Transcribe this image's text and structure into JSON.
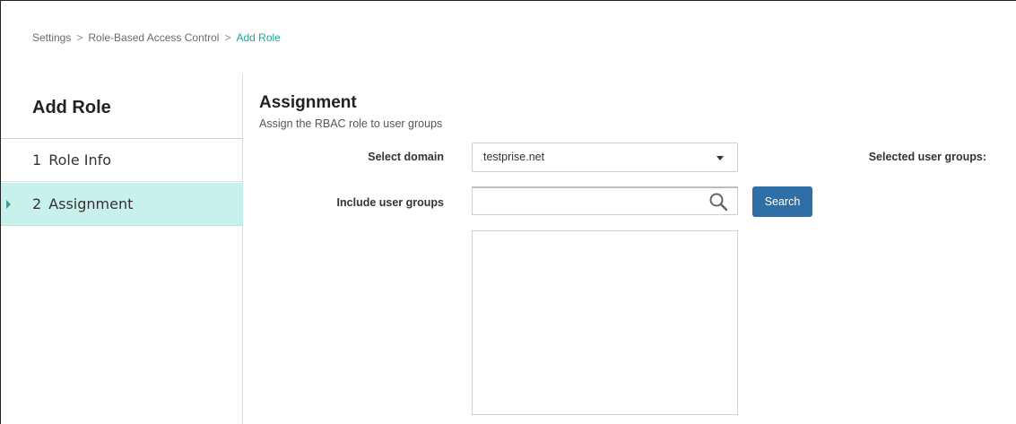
{
  "breadcrumb": {
    "items": [
      "Settings",
      "Role-Based Access Control",
      "Add Role"
    ],
    "separator": ">"
  },
  "sidebar": {
    "title": "Add Role",
    "steps": [
      {
        "number": "1",
        "label": "Role Info"
      },
      {
        "number": "2",
        "label": "Assignment"
      }
    ]
  },
  "main": {
    "title": "Assignment",
    "subtitle": "Assign the RBAC role to user groups",
    "select_domain": {
      "label": "Select domain",
      "value": "testprise.net"
    },
    "include_user_groups": {
      "label": "Include user groups",
      "value": "",
      "placeholder": "",
      "search_button": "Search"
    },
    "selected_user_groups_label": "Selected user groups:"
  },
  "colors": {
    "active_step_bg": "#c8f1ec",
    "breadcrumb_current": "#1aa89a",
    "primary_button": "#2f6fa8"
  }
}
